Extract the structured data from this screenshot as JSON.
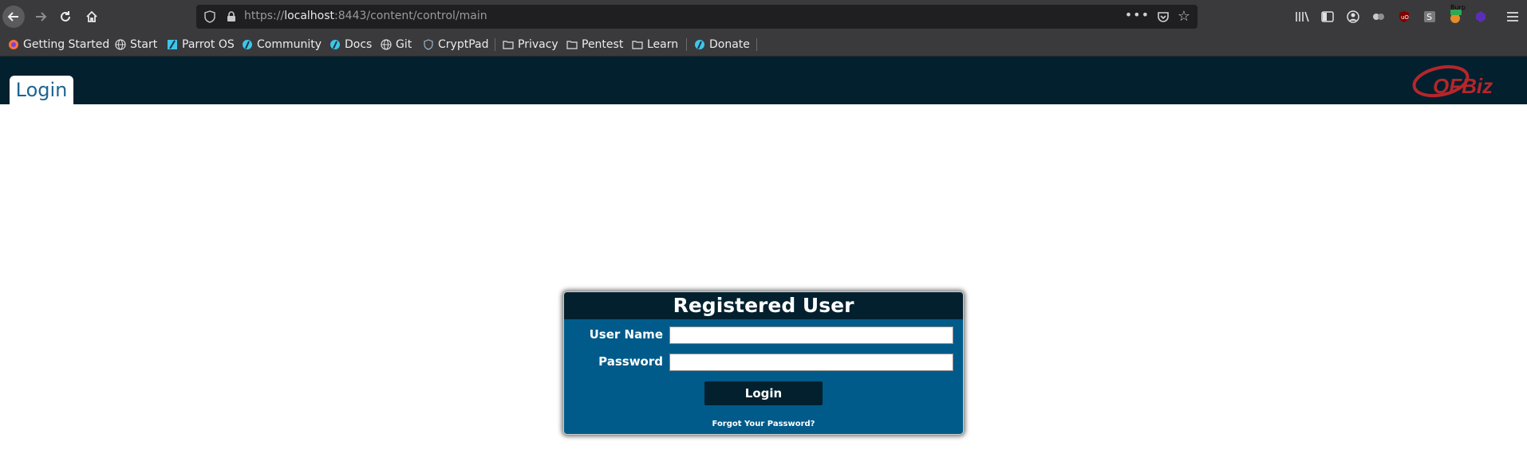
{
  "browser": {
    "url_prefix": "https://",
    "url_host": "localhost",
    "url_rest": ":8443/content/control/main",
    "url_more": "•••",
    "bookmarks": [
      {
        "label": "Getting Started",
        "icon": "firefox-icon"
      },
      {
        "label": "Start",
        "icon": "globe-icon"
      },
      {
        "label": "Parrot OS",
        "icon": "parrot-icon"
      },
      {
        "label": "Community",
        "icon": "parrot-circle-icon"
      },
      {
        "label": "Docs",
        "icon": "parrot-circle-icon"
      },
      {
        "label": "Git",
        "icon": "globe-icon"
      },
      {
        "label": "CryptPad",
        "icon": "shield-icon"
      },
      {
        "label": "Privacy",
        "icon": "folder-icon"
      },
      {
        "label": "Pentest",
        "icon": "folder-icon"
      },
      {
        "label": "Learn",
        "icon": "folder-icon"
      },
      {
        "label": "Donate",
        "icon": "parrot-circle-icon"
      }
    ],
    "extension_badge": "Burp"
  },
  "app": {
    "tab_label": "Login",
    "logo_text": "OFBiz",
    "login_box": {
      "title": "Registered User",
      "username_label": "User Name",
      "password_label": "Password",
      "username_value": "",
      "password_value": "",
      "login_button": "Login",
      "forgot_link": "Forgot Your Password?"
    }
  },
  "colors": {
    "header_bg": "#03202f",
    "box_bg": "#005b8a",
    "tab_text": "#1b6591",
    "browser_chrome": "#3a3a3c"
  }
}
